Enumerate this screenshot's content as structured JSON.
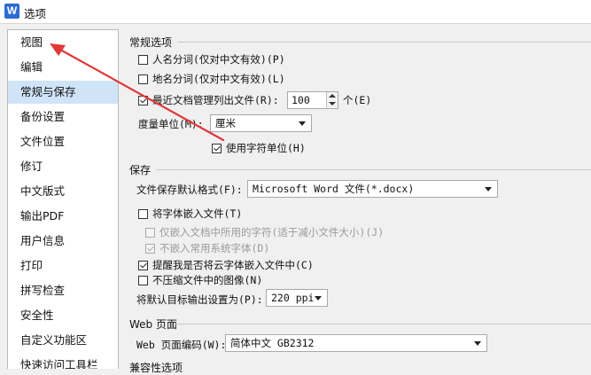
{
  "window": {
    "title": "选项",
    "app_icon_letter": "W"
  },
  "sidebar": {
    "items": [
      {
        "label": "视图"
      },
      {
        "label": "编辑"
      },
      {
        "label": "常规与保存",
        "selected": true
      },
      {
        "label": "备份设置"
      },
      {
        "label": "文件位置"
      },
      {
        "label": "修订"
      },
      {
        "label": "中文版式"
      },
      {
        "label": "输出PDF"
      },
      {
        "label": "用户信息"
      },
      {
        "label": "打印"
      },
      {
        "label": "拼写检查"
      },
      {
        "label": "安全性"
      },
      {
        "label": "自定义功能区"
      },
      {
        "label": "快速访问工具栏"
      }
    ]
  },
  "general": {
    "section_title": "常规选项",
    "name_split_label": "人名分词(仅对中文有效)(P)",
    "name_split_checked": false,
    "place_split_label": "地名分词(仅对中文有效)(L)",
    "place_split_checked": false,
    "recent_files_label": "最近文档管理列出文件(R):",
    "recent_files_checked": true,
    "recent_files_value": "100",
    "recent_files_unit": "个(E)",
    "measure_label": "度量单位(M):",
    "measure_value": "厘米",
    "char_unit_label": "使用字符单位(H)",
    "char_unit_checked": true
  },
  "save": {
    "section_title": "保存",
    "default_format_label": "文件保存默认格式(F):",
    "default_format_value": "Microsoft Word 文件(*.docx)",
    "embed_fonts_label": "将字体嵌入文件(T)",
    "embed_fonts_checked": false,
    "embed_used_only_label": "仅嵌入文档中所用的字符(适于减小文件大小)(J)",
    "embed_used_only_checked": false,
    "no_common_fonts_label": "不嵌入常用系统字体(D)",
    "no_common_fonts_checked": true,
    "cloud_font_remind_label": "提醒我是否将云字体嵌入文件中(C)",
    "cloud_font_remind_checked": true,
    "no_compress_label": "不压缩文件中的图像(N)",
    "no_compress_checked": false,
    "target_output_label": "将默认目标输出设置为(P):",
    "target_output_value": "220 ppi"
  },
  "web": {
    "section_title": "Web 页面",
    "encoding_label": "Web 页面编码(W):",
    "encoding_value": "简体中文 GB2312"
  },
  "compat": {
    "section_title": "兼容性选项"
  },
  "annotation": {
    "arrow_color": "#e0383a"
  },
  "colors": {
    "selected_item_bg": "#cfe4f7",
    "window_bg": "#f0f0f0"
  }
}
